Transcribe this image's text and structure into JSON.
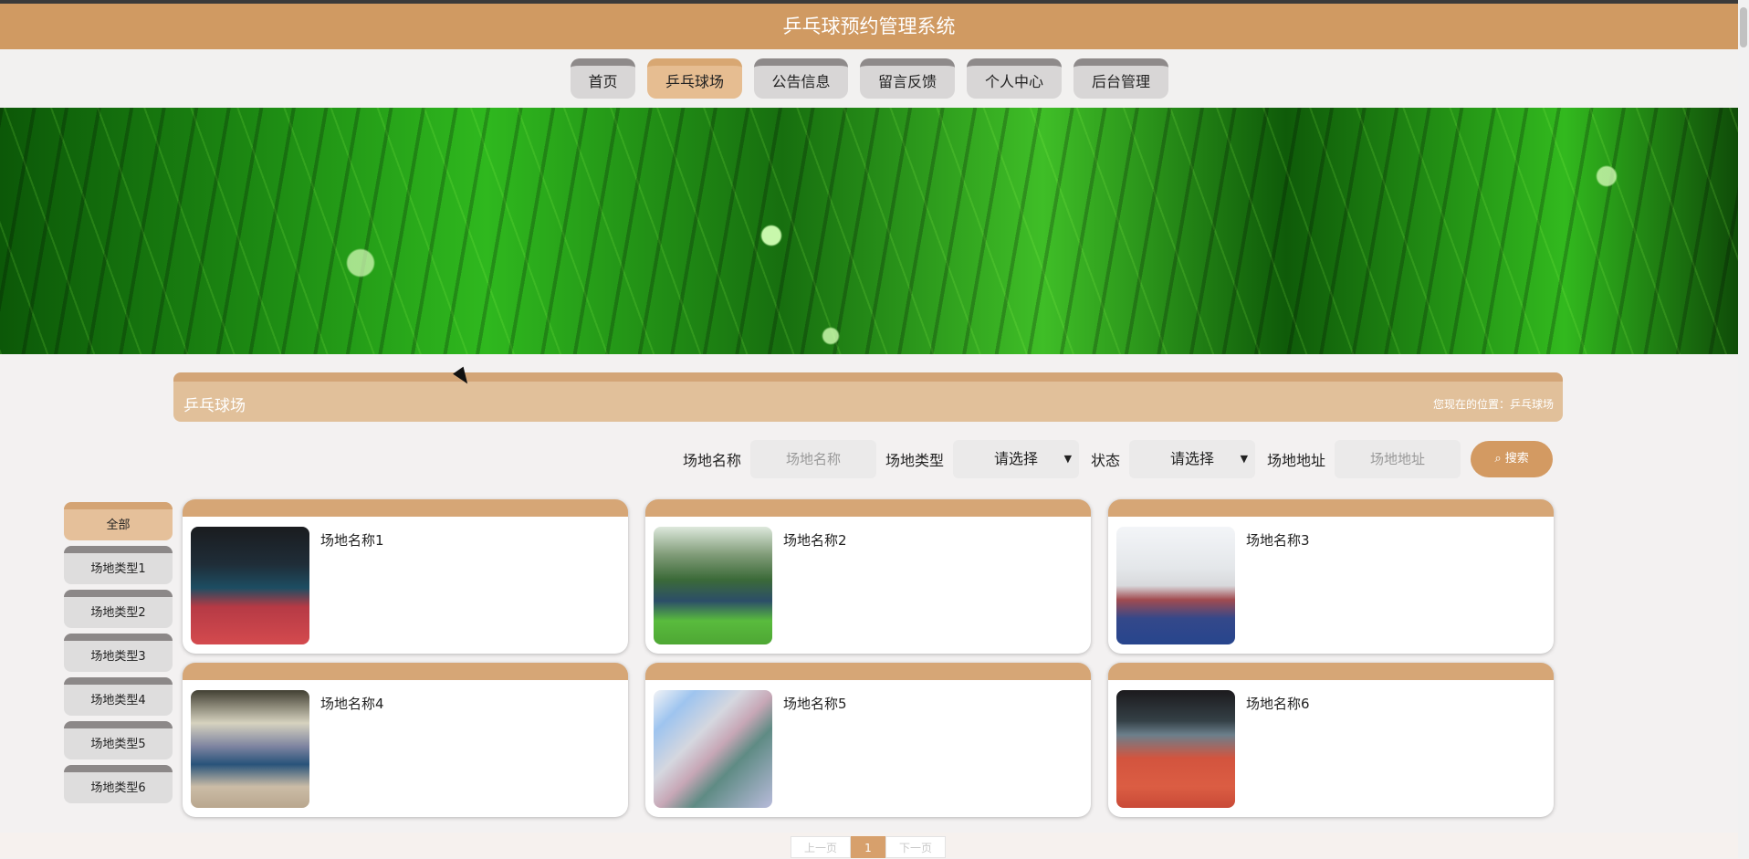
{
  "app": {
    "title": "乒乓球预约管理系统"
  },
  "nav": {
    "items": [
      {
        "label": "首页"
      },
      {
        "label": "乒乓球场"
      },
      {
        "label": "公告信息"
      },
      {
        "label": "留言反馈"
      },
      {
        "label": "个人中心"
      },
      {
        "label": "后台管理"
      }
    ]
  },
  "section": {
    "title": "乒乓球场",
    "breadcrumb": "您现在的位置：乒乓球场"
  },
  "search": {
    "name_label": "场地名称",
    "name_placeholder": "场地名称",
    "type_label": "场地类型",
    "type_value": "请选择",
    "status_label": "状态",
    "status_value": "请选择",
    "address_label": "场地地址",
    "address_placeholder": "场地地址",
    "button_label": "搜索"
  },
  "sidebar": {
    "items": [
      {
        "label": "全部"
      },
      {
        "label": "场地类型1"
      },
      {
        "label": "场地类型2"
      },
      {
        "label": "场地类型3"
      },
      {
        "label": "场地类型4"
      },
      {
        "label": "场地类型5"
      },
      {
        "label": "场地类型6"
      }
    ]
  },
  "courts": [
    {
      "name": "场地名称1"
    },
    {
      "name": "场地名称2"
    },
    {
      "name": "场地名称3"
    },
    {
      "name": "场地名称4"
    },
    {
      "name": "场地名称5"
    },
    {
      "name": "场地名称6"
    }
  ],
  "pagination": {
    "prev": "上一页",
    "current": "1",
    "next": "下一页"
  },
  "colors": {
    "primary": "#d09a62",
    "accent_light": "#e1c09a",
    "nav_inactive": "#d8d6d6"
  }
}
